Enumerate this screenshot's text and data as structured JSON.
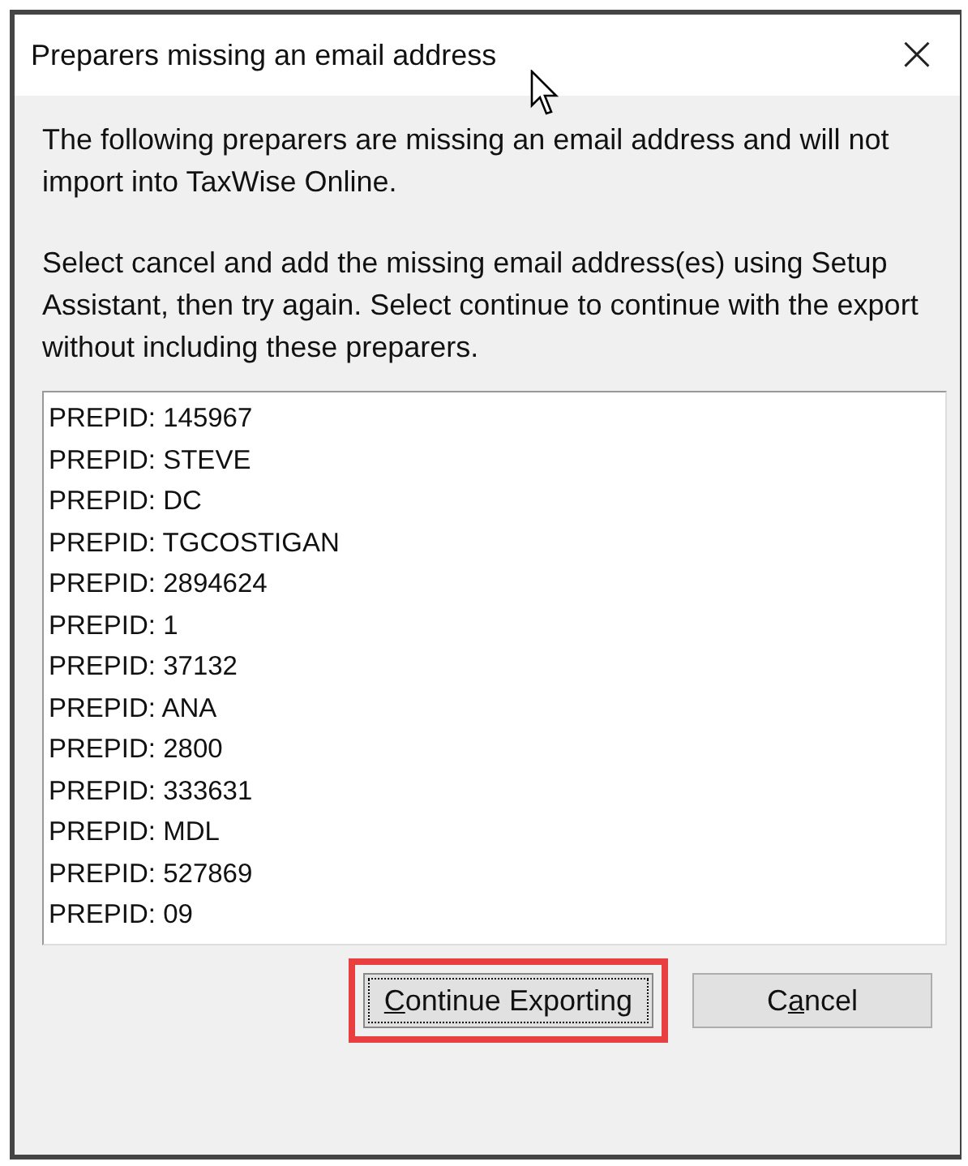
{
  "window": {
    "title": "Preparers missing an email address",
    "close": "×"
  },
  "paragraphs": [
    "The following preparers are missing an email address and will not import into TaxWise Online.",
    "Select cancel and add the missing email address(es) using Setup Assistant, then try again. Select continue to continue with the export without including these preparers."
  ],
  "list": {
    "items": [
      "PREPID: 145967",
      "PREPID: STEVE",
      "PREPID: DC",
      "PREPID: TGCOSTIGAN",
      "PREPID: 2894624",
      "PREPID: 1",
      "PREPID: 37132",
      "PREPID: ANA",
      "PREPID: 2800",
      "PREPID: 333631",
      "PREPID: MDL",
      "PREPID: 527869",
      "PREPID: 09"
    ]
  },
  "buttons": [
    {
      "key": "C",
      "after": "ontinue Exporting",
      "focused": true,
      "highlighted": true
    },
    {
      "before": "C",
      "key": "a",
      "after": "ncel",
      "focused": false,
      "highlighted": false
    }
  ]
}
